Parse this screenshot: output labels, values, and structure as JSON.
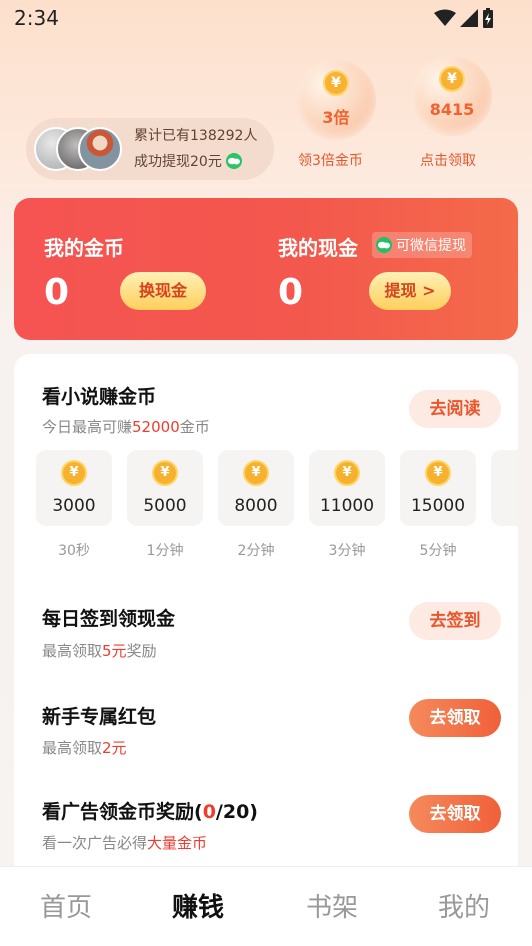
{
  "status_bar": {
    "time": "2:34"
  },
  "user_pill": {
    "line1": "累计已有138292人",
    "line2": "成功提现20元"
  },
  "bubbles": [
    {
      "coin": "¥",
      "value": "3倍",
      "label": "领3倍金币"
    },
    {
      "coin": "¥",
      "value": "8415",
      "label": "点击领取"
    }
  ],
  "wallet": {
    "coins_title": "我的金币",
    "coins_value": "0",
    "coins_button": "换现金",
    "cash_title": "我的现金",
    "cash_value": "0",
    "cash_button": "提现 >",
    "wechat_tag": "可微信提现"
  },
  "tasks": {
    "read": {
      "title": "看小说赚金币",
      "sub_prefix": "今日最高可赚",
      "sub_value": "52000",
      "sub_suffix": "金币",
      "button": "去阅读"
    },
    "coin_tiers": [
      {
        "coin": "¥",
        "amount": "3000",
        "time": "30秒"
      },
      {
        "coin": "¥",
        "amount": "5000",
        "time": "1分钟"
      },
      {
        "coin": "¥",
        "amount": "8000",
        "time": "2分钟"
      },
      {
        "coin": "¥",
        "amount": "11000",
        "time": "3分钟"
      },
      {
        "coin": "¥",
        "amount": "15000",
        "time": "5分钟"
      }
    ],
    "checkin": {
      "title": "每日签到领现金",
      "sub_prefix": "最高领取",
      "sub_value": "5元",
      "sub_suffix": "奖励",
      "button": "去签到"
    },
    "newbie": {
      "title": "新手专属红包",
      "sub_prefix": "最高领取",
      "sub_value": "2元",
      "button": "去领取"
    },
    "ads": {
      "title_prefix": "看广告领金币奖励(",
      "title_count": "0",
      "title_suffix": "/20)",
      "sub_prefix": "看一次广告必得",
      "sub_value": "大量金币",
      "button": "去领取"
    }
  },
  "bottom_nav": [
    {
      "label": "首页",
      "active": false
    },
    {
      "label": "赚钱",
      "active": true
    },
    {
      "label": "书架",
      "active": false
    },
    {
      "label": "我的",
      "active": false
    }
  ],
  "colors": {
    "accent_red": "#f55452",
    "brand_orange": "#f0603a",
    "wechat_green": "#21c063",
    "coin_gold": "#f6b22f"
  }
}
